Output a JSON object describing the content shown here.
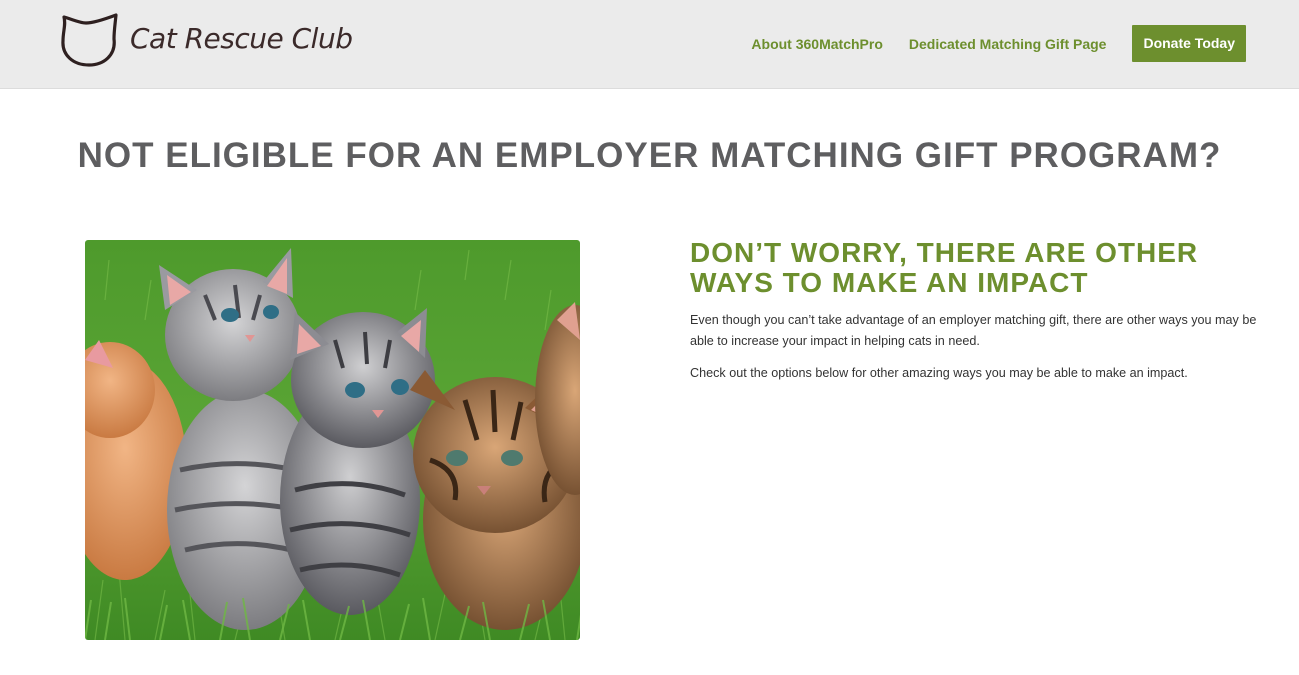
{
  "colors": {
    "accent": "#6d8f2e",
    "header_bg": "#ebebeb",
    "title_gray": "#5e5e60",
    "body_text": "#333333"
  },
  "header": {
    "logo_icon": "cat-head-icon",
    "logo_text": "Cat Rescue Club",
    "nav": {
      "about_label": "About 360MatchPro",
      "matching_label": "Dedicated Matching Gift Page",
      "donate_label": "Donate Today"
    }
  },
  "main": {
    "title": "NOT ELIGIBLE FOR AN EMPLOYER MATCHING GIFT PROGRAM?",
    "image": "kittens-photo",
    "subheading": "DON’T WORRY, THERE ARE OTHER WAYS TO MAKE AN IMPACT",
    "paragraph_1": "Even though you can’t take advantage of an employer matching gift, there are other ways you may be able to increase your impact in helping cats in need.",
    "paragraph_2": "Check out the options below for other amazing ways you may be able to make an impact."
  }
}
